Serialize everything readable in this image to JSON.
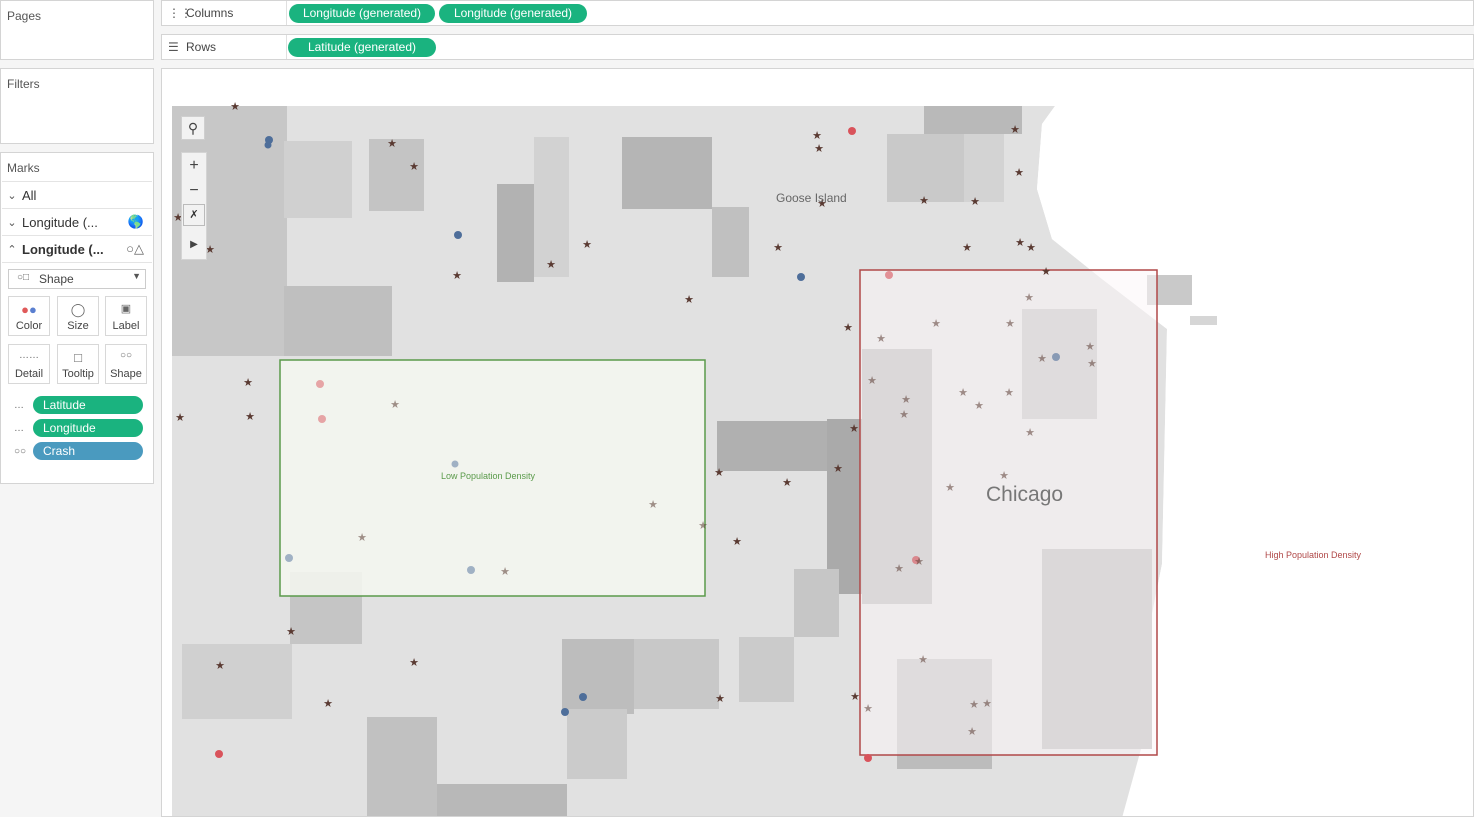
{
  "pages_panel": {
    "title": "Pages"
  },
  "filters_panel": {
    "title": "Filters"
  },
  "marks_panel": {
    "title": "Marks",
    "rows": [
      {
        "label": "All",
        "expanded": false
      },
      {
        "label": "Longitude (...",
        "expanded": false,
        "icon": "map-icon"
      },
      {
        "label": "Longitude (...",
        "expanded": true,
        "icon": "shape-icon"
      }
    ],
    "mark_type": "Shape",
    "buttons": [
      "Color",
      "Size",
      "Label",
      "Detail",
      "Tooltip",
      "Shape"
    ],
    "fields": [
      {
        "label": "Latitude",
        "color": "#1ab37f",
        "icon": "detail-icon"
      },
      {
        "label": "Longitude",
        "color": "#1ab37f",
        "icon": "detail-icon"
      },
      {
        "label": "Crash",
        "color": "#4a9abf",
        "icon": "shape-icon"
      }
    ]
  },
  "columns_shelf": {
    "label": "Columns",
    "pills": [
      "Longitude (generated)",
      "Longitude (generated)"
    ]
  },
  "rows_shelf": {
    "label": "Rows",
    "pills": [
      "Latitude (generated)"
    ]
  },
  "map": {
    "labels": {
      "goose_island": "Goose Island",
      "chicago": "Chicago"
    },
    "annotations": {
      "low": "Low Population Density",
      "high": "High Population Density"
    },
    "colors": {
      "low_box": "#5a9a4a",
      "high_box": "#b04848",
      "blue_marker": "#4e6e9a",
      "red_marker": "#d9535b",
      "star": "#5a3a32"
    }
  }
}
